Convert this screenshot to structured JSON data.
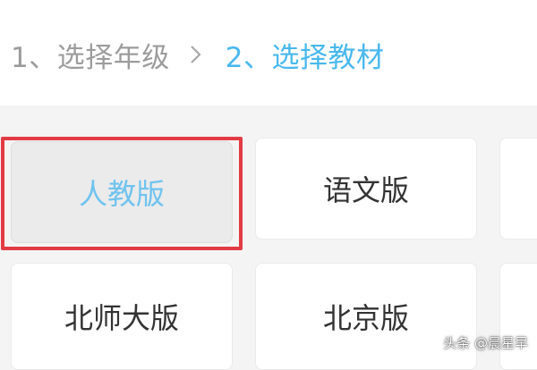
{
  "breadcrumb": {
    "step1": "1、选择年级",
    "step2": "2、选择教材"
  },
  "icons": {
    "separator": "chevron-right-icon"
  },
  "colors": {
    "active_step": "#48b8ee",
    "inactive_step": "#9c9c9c",
    "selected_label": "#6fc3ef",
    "highlight_border": "#e23b44"
  },
  "textbooks": {
    "items": [
      "人教版",
      "语文版",
      "北师大版",
      "北京版"
    ],
    "selected": "人教版"
  },
  "watermark": "头条 @晨星早"
}
